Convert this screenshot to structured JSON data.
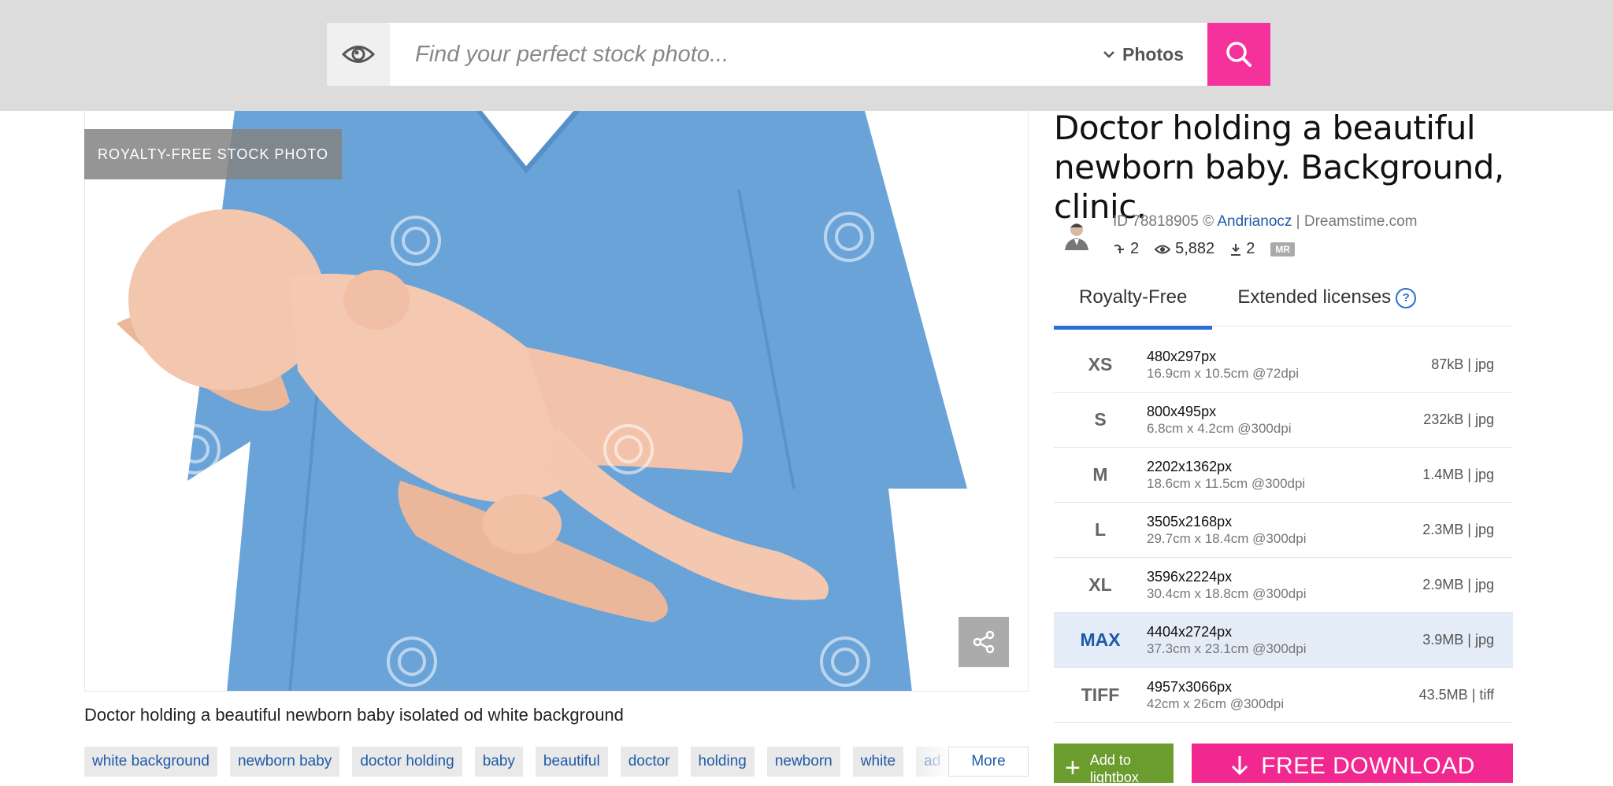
{
  "search": {
    "placeholder": "Find your perfect stock photo...",
    "type_label": "Photos"
  },
  "photo": {
    "badge": "ROYALTY-FREE STOCK PHOTO",
    "caption": "Doctor holding a beautiful newborn baby isolated od white background",
    "colors": {
      "scrubs": "#6aa3d8",
      "skin": "#f0c2a6"
    }
  },
  "tags": {
    "items": [
      "white background",
      "newborn baby",
      "doctor holding",
      "baby",
      "beautiful",
      "doctor",
      "holding",
      "newborn",
      "white",
      "ad"
    ],
    "more_label": "More"
  },
  "details": {
    "title": "Doctor holding a beautiful newborn baby. Background, clinic.",
    "id_text": "ID 78818905 © ",
    "author": "Andrianocz",
    "site_text": " | Dreamstime.com",
    "stats": {
      "favorites": "2",
      "views": "5,882",
      "downloads": "2",
      "mr_badge": "MR"
    }
  },
  "tabs": [
    {
      "label": "Royalty-Free",
      "active": true
    },
    {
      "label": "Extended licenses",
      "active": false
    }
  ],
  "sizes": [
    {
      "code": "XS",
      "px": "480x297px",
      "cm": "16.9cm x 10.5cm @72dpi",
      "file": "87kB | jpg"
    },
    {
      "code": "S",
      "px": "800x495px",
      "cm": "6.8cm x 4.2cm @300dpi",
      "file": "232kB | jpg"
    },
    {
      "code": "M",
      "px": "2202x1362px",
      "cm": "18.6cm x 11.5cm @300dpi",
      "file": "1.4MB | jpg"
    },
    {
      "code": "L",
      "px": "3505x2168px",
      "cm": "29.7cm x 18.4cm @300dpi",
      "file": "2.3MB | jpg"
    },
    {
      "code": "XL",
      "px": "3596x2224px",
      "cm": "30.4cm x 18.8cm @300dpi",
      "file": "2.9MB | jpg"
    },
    {
      "code": "MAX",
      "px": "4404x2724px",
      "cm": "37.3cm x 23.1cm @300dpi",
      "file": "3.9MB | jpg",
      "selected": true
    },
    {
      "code": "TIFF",
      "px": "4957x3066px",
      "cm": "42cm x 26cm @300dpi",
      "file": "43.5MB | tiff"
    }
  ],
  "actions": {
    "lightbox_label": "Add to lightbox",
    "download_label": "FREE DOWNLOAD"
  },
  "colors": {
    "accent_pink": "#f0288f",
    "accent_blue": "#2b6fd6",
    "lightbox_green": "#6b9c2e"
  }
}
